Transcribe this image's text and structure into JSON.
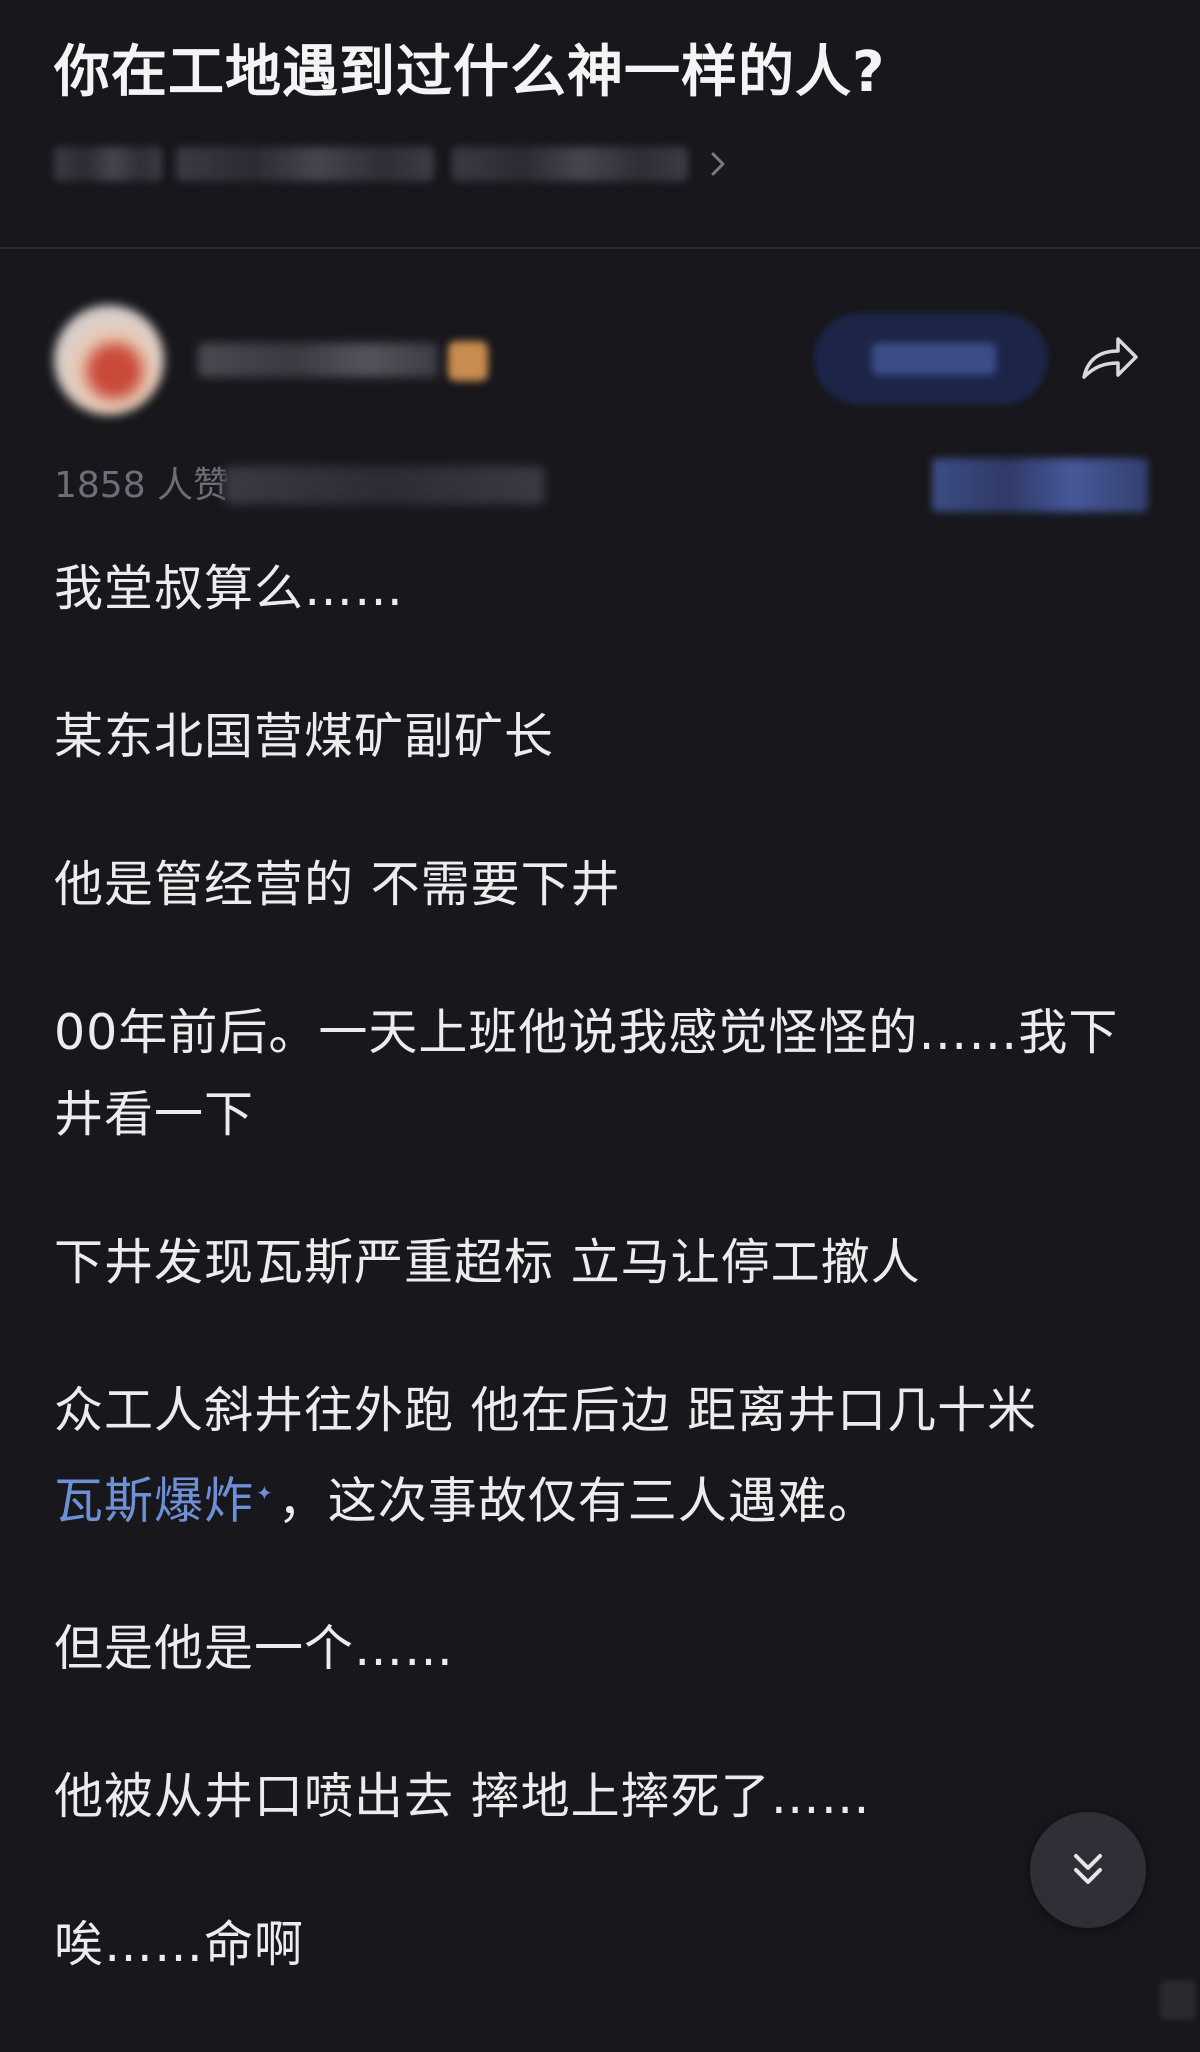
{
  "question": {
    "title": "你在工地遇到过什么神一样的人?"
  },
  "answer": {
    "meta_prefix": "1858 人赞",
    "paragraphs": [
      {
        "text": "我堂叔算么……"
      },
      {
        "text": "某东北国营煤矿副矿长"
      },
      {
        "text": "他是管经营的 不需要下井"
      },
      {
        "text": "00年前后。一天上班他说我感觉怪怪的……我下井看一下"
      },
      {
        "text": "下井发现瓦斯严重超标 立马让停工撤人"
      },
      {
        "text": "众工人斜井往外跑 他在后边 距离井口几十米",
        "link": "瓦斯爆炸",
        "after": "，这次事故仅有三人遇难。"
      },
      {
        "text": "但是他是一个……"
      },
      {
        "text": "他被从井口喷出去 摔地上摔死了……"
      },
      {
        "text": "唉……命啊"
      }
    ]
  },
  "colors": {
    "background": "#17171c",
    "text": "#ececef",
    "link": "#6f8fd6",
    "muted": "#6e6e78"
  },
  "icons": {
    "topic_chevron": "chevron-right-icon",
    "share": "share-icon",
    "scroll_down": "double-chevron-down-icon",
    "term_marker": "sparkle-icon"
  }
}
